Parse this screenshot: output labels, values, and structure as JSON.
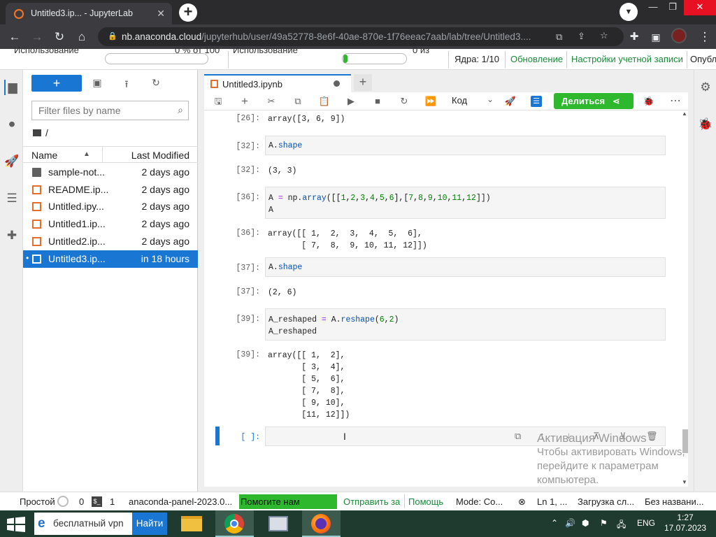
{
  "browser": {
    "tab_title": "Untitled3.ip... - JupyterLab",
    "url_host": "nb.anaconda.cloud",
    "url_path": "/jupyterhub/user/49a52778-8e6f-40ae-870e-1f76eeac7aab/lab/tree/Untitled3...."
  },
  "anaconda_bar": {
    "usage_label_1": "Использование",
    "usage_value_1": "0 % от 100",
    "usage_label_2": "Использование",
    "usage_value_2": "0 из",
    "usage_fill_2": 0.03,
    "cores": "Ядра: 1/10",
    "update_link": "Обновление",
    "account_link": "Настройки учетной записи",
    "publish_link": "Опубл"
  },
  "filebrowser": {
    "filter_placeholder": "Filter files by name",
    "breadcrumb": "/",
    "col_name": "Name",
    "col_modified": "Last Modified",
    "files": [
      {
        "name": "sample-not...",
        "modified": "2 days ago",
        "type": "folder"
      },
      {
        "name": "README.ip...",
        "modified": "2 days ago",
        "type": "notebook"
      },
      {
        "name": "Untitled.ipy...",
        "modified": "2 days ago",
        "type": "notebook"
      },
      {
        "name": "Untitled1.ip...",
        "modified": "2 days ago",
        "type": "notebook"
      },
      {
        "name": "Untitled2.ip...",
        "modified": "2 days ago",
        "type": "notebook"
      },
      {
        "name": "Untitled3.ip...",
        "modified": "in 18 hours",
        "type": "notebook",
        "selected": true
      }
    ]
  },
  "notebook": {
    "tab_title": "Untitled3.ipynb",
    "kernel_mode": "Код",
    "share_label": "Делиться",
    "cells": [
      {
        "prompt": "[26]:",
        "kind": "output",
        "text": "array([3, 6, 9])"
      },
      {
        "prompt": "[32]:",
        "kind": "input",
        "text": "A.shape"
      },
      {
        "prompt": "[32]:",
        "kind": "output",
        "text": "(3, 3)"
      },
      {
        "prompt": "[36]:",
        "kind": "input",
        "text": "A = np.array([[1,2,3,4,5,6],[7,8,9,10,11,12]])\nA"
      },
      {
        "prompt": "[36]:",
        "kind": "output",
        "text": "array([[ 1,  2,  3,  4,  5,  6],\n       [ 7,  8,  9, 10, 11, 12]])"
      },
      {
        "prompt": "[37]:",
        "kind": "input",
        "text": "A.shape"
      },
      {
        "prompt": "[37]:",
        "kind": "output",
        "text": "(2, 6)"
      },
      {
        "prompt": "[39]:",
        "kind": "input",
        "text": "A_reshaped = A.reshape(6,2)\nA_reshaped"
      },
      {
        "prompt": "[39]:",
        "kind": "output",
        "text": "array([[ 1,  2],\n       [ 3,  4],\n       [ 5,  6],\n       [ 7,  8],\n       [ 9, 10],\n       [11, 12]])"
      },
      {
        "prompt": "[ ]:",
        "kind": "input",
        "text": "",
        "active": true
      }
    ]
  },
  "statusbar": {
    "mode": "Простой",
    "zero": "0",
    "terminal_count": "1",
    "panel": "anaconda-panel-2023.0...",
    "help_banner": "Помогите нам улучшить",
    "send_link": "Отправить за",
    "help_link": "Помощь",
    "edit_mode": "Mode: Co...",
    "position": "Ln 1, ...",
    "loading": "Загрузка сл...",
    "untitled": "Без названи..."
  },
  "taskbar": {
    "search_text": "бесплатный vpn",
    "find_button": "Найти",
    "lang": "ENG",
    "time": "1:27",
    "date": "17.07.2023"
  },
  "watermark": {
    "line1": "Активация Windows",
    "line2": "Чтобы активировать Windows,",
    "line3": "перейдите к параметрам",
    "line4": "компьютера."
  },
  "colors": {
    "jupyter_blue": "#1976d2",
    "share_green": "#2eb82e",
    "anaconda_link": "#1a8a3a"
  }
}
